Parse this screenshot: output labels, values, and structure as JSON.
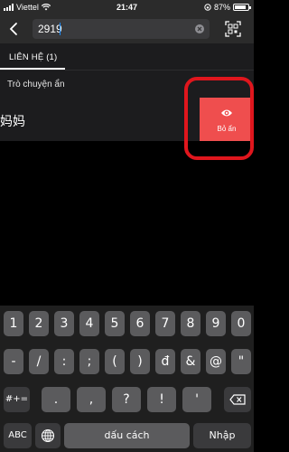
{
  "status_bar": {
    "carrier": "Viettel",
    "time": "21:47",
    "battery_label": "87%",
    "battery_level": 0.87
  },
  "search": {
    "query": "2919",
    "back_icon": "chevron-left-icon",
    "clear_icon": "clear-x-icon",
    "qr_icon": "qr-scan-icon"
  },
  "tabs": [
    {
      "label": "LIÊN HỆ (1)",
      "active": true
    }
  ],
  "results": {
    "section_title": "Trò chuyện ẩn",
    "rows": [
      {
        "name": "妈妈",
        "action_label": "Bỏ ẩn",
        "action_icon": "eye-icon",
        "action_color": "#ef4e4e"
      }
    ]
  },
  "highlight_color": "#e0161d",
  "keyboard": {
    "row1": [
      "1",
      "2",
      "3",
      "4",
      "5",
      "6",
      "7",
      "8",
      "9",
      "0"
    ],
    "row2": [
      "-",
      "/",
      ":",
      ";",
      "(",
      ")",
      "đ",
      "&",
      "@",
      "\""
    ],
    "row3": [
      "#+=",
      ".",
      ",",
      "?",
      "!",
      "'"
    ],
    "row4": [
      "ABC",
      "dấu cách",
      "Nhập"
    ]
  }
}
